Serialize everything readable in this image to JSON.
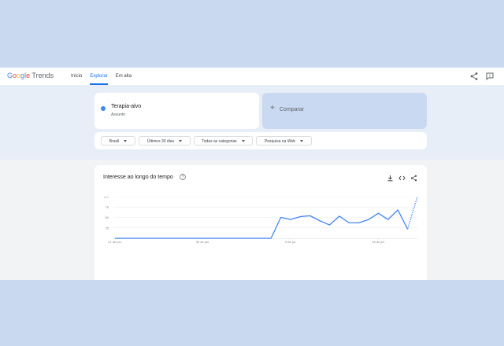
{
  "header": {
    "logo_google": [
      "G",
      "o",
      "o",
      "g",
      "l",
      "e"
    ],
    "logo_trends": "Trends",
    "nav": [
      {
        "label": "Início",
        "active": false
      },
      {
        "label": "Explorar",
        "active": true
      },
      {
        "label": "Em alta",
        "active": false
      }
    ],
    "icons": [
      "share-icon",
      "feedback-icon"
    ]
  },
  "search_term": {
    "title": "Terapia-alvo",
    "subtitle": "Assunto",
    "color": "#4285f4"
  },
  "compare": {
    "plus": "+",
    "label": "Comparar"
  },
  "filters": {
    "region": "Brasil",
    "time": "Últimos 30 dias",
    "category": "Todas as categorias",
    "search_type": "Pesquisa na Web"
  },
  "chart_card": {
    "title": "Interesse ao longo do tempo",
    "icons": [
      "help-icon",
      "download-icon",
      "embed-icon",
      "share-icon"
    ]
  },
  "chart_data": {
    "type": "line",
    "title": "Interesse ao longo do tempo",
    "xlabel": "",
    "ylabel": "",
    "ylim": [
      0,
      100
    ],
    "yticks": [
      "100",
      "75",
      "50",
      "25"
    ],
    "xticks": [
      "21 de jun.",
      "30 de jun.",
      "9 de jul.",
      "18 de jul."
    ],
    "color": "#4285f4",
    "grid": true,
    "series": [
      {
        "values": [
          0,
          0,
          0,
          0,
          0,
          0,
          0,
          0,
          0,
          0,
          0,
          0,
          0,
          0,
          0,
          0,
          0,
          50,
          45,
          52,
          54,
          42,
          32,
          53,
          37,
          37,
          45,
          60,
          45,
          68,
          22,
          100
        ],
        "partial_last_point": true
      }
    ]
  }
}
